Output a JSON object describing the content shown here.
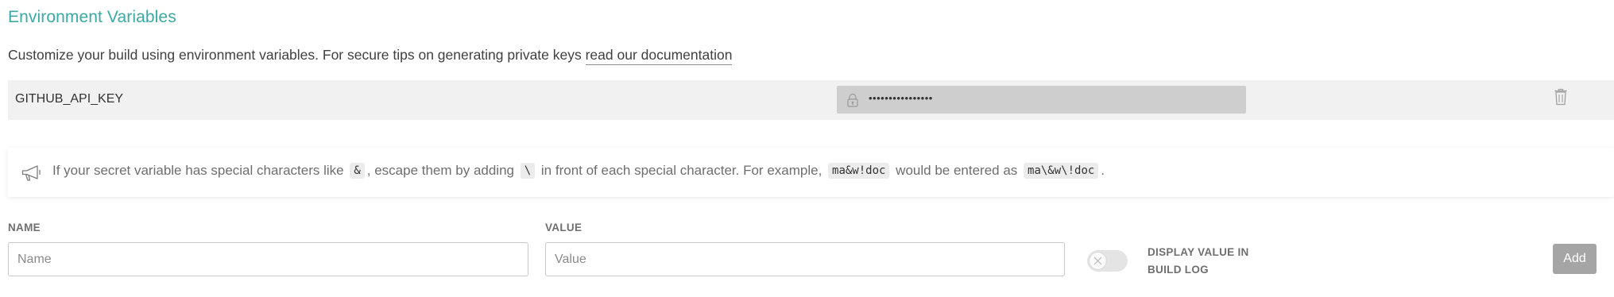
{
  "section": {
    "title": "Environment Variables",
    "description": "Customize your build using environment variables. For secure tips on generating private keys ",
    "doc_link": "read our documentation"
  },
  "variables": [
    {
      "name": "GITHUB_API_KEY",
      "value_masked": "••••••••••••••••",
      "icons": {
        "lock": "lock-icon",
        "delete": "trash-icon"
      }
    }
  ],
  "notice": {
    "icon": "megaphone-icon",
    "t1": "If your secret variable has special characters like ",
    "c1": "&",
    "t2": ", escape them by adding ",
    "c2": "\\",
    "t3": " in front of each special character. For example, ",
    "c3": "ma&w!doc",
    "t4": " would be entered as ",
    "c4": "ma\\&w\\!doc",
    "t5": "."
  },
  "form": {
    "name_label": "NAME",
    "name_placeholder": "Name",
    "name_value": "",
    "value_label": "VALUE",
    "value_placeholder": "Value",
    "value_value": "",
    "display_toggle_label_line1": "DISPLAY VALUE IN",
    "display_toggle_label_line2": "BUILD LOG",
    "display_toggle_on": false,
    "add_label": "Add"
  },
  "colors": {
    "title": "#39aaa4",
    "row_bg": "#f1f1f1",
    "masked_bg": "#cecece",
    "add_button": "#a5a5a5"
  }
}
